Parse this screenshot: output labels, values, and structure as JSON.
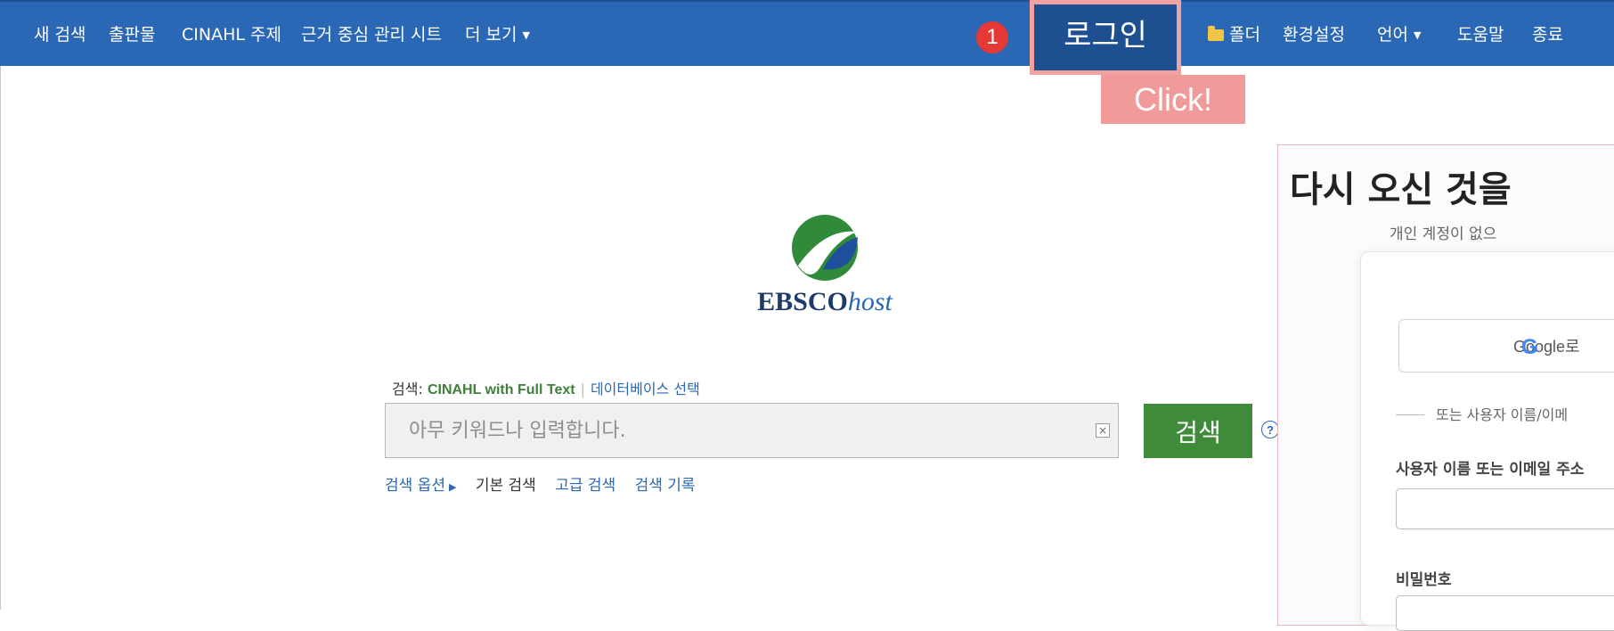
{
  "nav": {
    "new_search": "새 검색",
    "publications": "출판물",
    "cinahl_subjects": "CINAHL 주제",
    "evidence_based": "근거 중심 관리 시트",
    "more": "더 보기",
    "login": "로그인",
    "folder": "폴더",
    "preferences": "환경설정",
    "language": "언어",
    "help": "도움말",
    "exit": "종료"
  },
  "annotation": {
    "step_number": "1",
    "click_label": "Click!"
  },
  "logo": {
    "brand_bold": "EBSCO",
    "brand_italic": "host"
  },
  "search": {
    "label_prefix": "검색:",
    "database": "CINAHL with Full Text",
    "choose_db": "데이터베이스 선택",
    "placeholder": "아무 키워드나 입력합니다.",
    "button": "검색",
    "options": "검색 옵션",
    "basic": "기본 검색",
    "advanced": "고급 검색",
    "history": "검색 기록"
  },
  "login_panel": {
    "title": "다시 오신 것을",
    "subtitle": "개인 계정이 없으",
    "google_button": "Google로",
    "divider": "또는 사용자 이름/이메",
    "username_label": "사용자 이름 또는 이메일 주소",
    "password_label": "비밀번호"
  },
  "colors": {
    "nav_bg": "#2a67b4",
    "login_box": "#1d4f91",
    "highlight": "#f3a2a2",
    "step_red": "#e53935",
    "search_green": "#3f8b3a"
  }
}
